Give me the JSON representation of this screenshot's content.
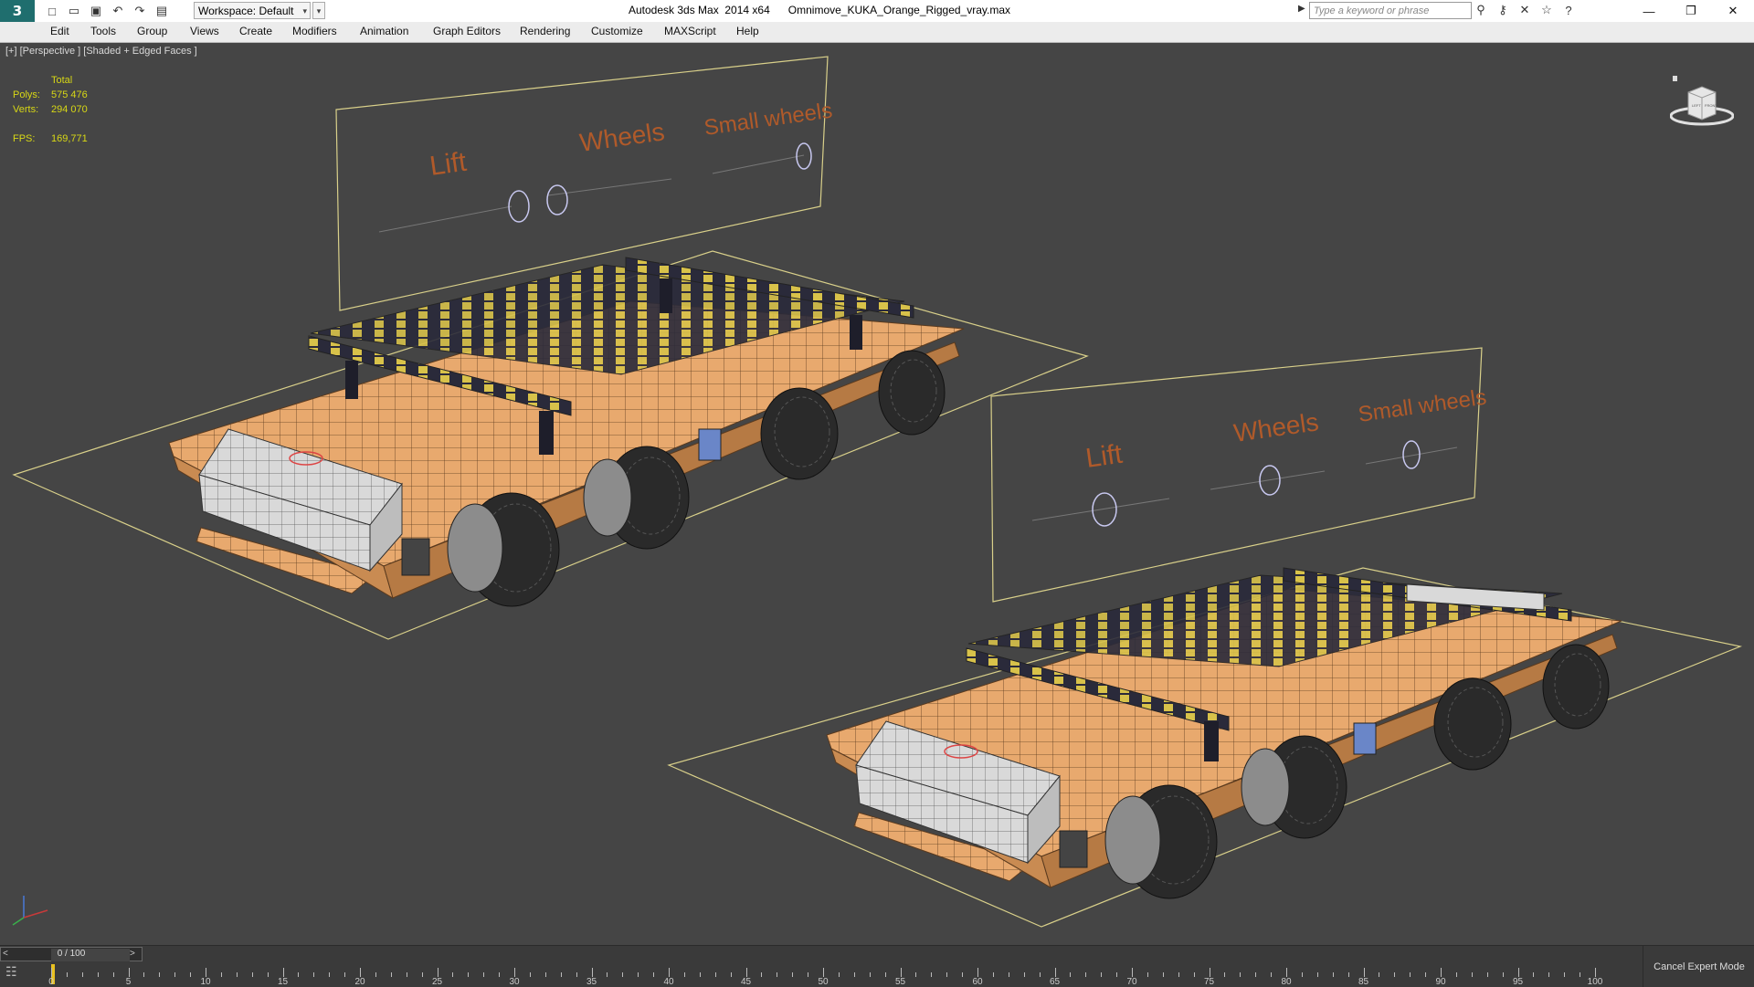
{
  "titlebar": {
    "workspace_label": "Workspace: Default",
    "app_name": "Autodesk 3ds Max  2014 x64",
    "file_name": "Omnimove_KUKA_Orange_Rigged_vray.max",
    "search_placeholder": "Type a keyword or phrase"
  },
  "menu": [
    "Edit",
    "Tools",
    "Group",
    "Views",
    "Create",
    "Modifiers",
    "Animation",
    "Graph Editors",
    "Rendering",
    "Customize",
    "MAXScript",
    "Help"
  ],
  "viewport": {
    "label": "[+] [Perspective ] [Shaded + Edged Faces ]",
    "stats": {
      "total_label": "Total",
      "polys_label": "Polys:",
      "polys_value": "575 476",
      "verts_label": "Verts:",
      "verts_value": "294 070",
      "fps_label": "FPS:",
      "fps_value": "169,771"
    },
    "panel_labels": {
      "lift": "Lift",
      "wheels": "Wheels",
      "small_wheels": "Small wheels"
    },
    "viewcube": {
      "left": "LEFT",
      "front": "FRONT"
    }
  },
  "timeline": {
    "frame_display": "0 / 100",
    "ruler_labels": [
      "0",
      "5",
      "10",
      "15",
      "20",
      "25",
      "30",
      "35",
      "40",
      "45",
      "50",
      "55",
      "60",
      "65",
      "70",
      "75",
      "80",
      "85",
      "90",
      "95",
      "100"
    ],
    "cancel_expert": "Cancel Expert Mode"
  },
  "colors": {
    "viewport_bg": "#454545",
    "orange": "#e8a96e",
    "label_orange": "#b05a2a",
    "yellow": "#d8d815",
    "wire": "#d9d08a"
  }
}
